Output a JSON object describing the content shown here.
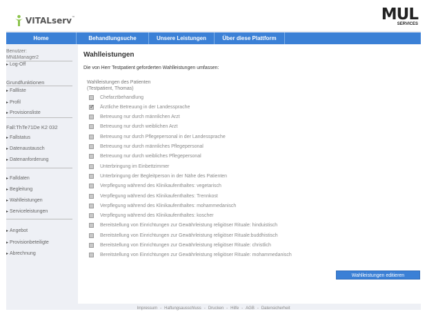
{
  "header": {
    "logo_vitalserv": "VITALserv",
    "logo_tm": "™",
    "logo_mul": "MUL",
    "logo_mul_sub": "SERVICES"
  },
  "nav": {
    "items": [
      "Home",
      "Behandlungsuche",
      "Unsere Leistungen",
      "Über diese Plattform"
    ]
  },
  "sidebar": {
    "user_label": "Benutzer:",
    "user_name": "MN&Manager2",
    "logoff": "Log-Off",
    "grund_title": "Grundfunktionen",
    "grund_items": [
      "Fallliste",
      "Profil",
      "Provisionsliste"
    ],
    "fall_title": "Fall:ThTe71De K2 032",
    "fall_items": [
      "Fallstatus",
      "Datenaustausch",
      "Datenanforderung"
    ],
    "case_items": [
      "Falldaten",
      "Begleitung",
      "Wahlleistungen",
      "Serviceleistungen"
    ],
    "other_items": [
      "Angebot",
      "Provisionbeteiligte",
      "Abrechnung"
    ]
  },
  "main": {
    "title": "Wahlleistungen",
    "intro": "Die von Herr Testpatient geforderten Wahlleistungen umfassen:",
    "section_title": "Wahlleistungen des Patienten",
    "section_sub": "(Testpatient, Thomas)",
    "items": [
      {
        "label": "Chefarztbehandlung",
        "checked": false
      },
      {
        "label": "Ärztliche Betreuung in der Landessprache",
        "checked": true
      },
      {
        "label": "Betreuung nur durch männlichen Arzt",
        "checked": false
      },
      {
        "label": "Betreuung nur durch weiblichen Arzt",
        "checked": false
      },
      {
        "label": "Betreuung nur durch Pflegepersonal in der Landessprache",
        "checked": false
      },
      {
        "label": "Betreuung nur durch männliches Pflegepersonal",
        "checked": false
      },
      {
        "label": "Betreuung nur durch weibliches Pflegepersonal",
        "checked": false
      },
      {
        "label": "Unterbringung im Einbettzimmer",
        "checked": false
      },
      {
        "label": "Unterbringung der Begleitperson in der Nähe des Patienten",
        "checked": false
      },
      {
        "label": "Verpflegung während des Klinikaufenthaltes: vegetarisch",
        "checked": false
      },
      {
        "label": "Verpflegung während des Klinikaufenthaltes: Trennkost",
        "checked": false
      },
      {
        "label": "Verpflegung während des Klinikaufenthaltes: mohammedanisch",
        "checked": false
      },
      {
        "label": "Verpflegung während des Klinikaufenthaltes: koscher",
        "checked": false
      },
      {
        "label": "Bereitstellung von Einrichtungen zur Gewährleistung religiöser Rituale: hinduistisch",
        "checked": false
      },
      {
        "label": "Bereitstellung von Einrichtungen zur Gewährleistung religiöser Rituale:buddhistisch",
        "checked": false
      },
      {
        "label": "Bereitstellung von Einrichtungen zur Gewährleistung religiöser Rituale: christlich",
        "checked": false
      },
      {
        "label": "Bereitstellung von Einrichtungen zur Gewährleistung religiöser Rituale: mohammedanisch",
        "checked": false
      }
    ],
    "edit_button": "Wahlleistungen editieren"
  },
  "footer": {
    "links": [
      "Impressum",
      "Haftungsausschluss",
      "Drucken",
      "Hilfe",
      "AGB",
      "Datensicherheit"
    ],
    "separator": "-"
  },
  "colors": {
    "nav_blue": "#3b80d6",
    "frame_bg": "#eef0f5",
    "logo_green": "#8bc34a"
  }
}
